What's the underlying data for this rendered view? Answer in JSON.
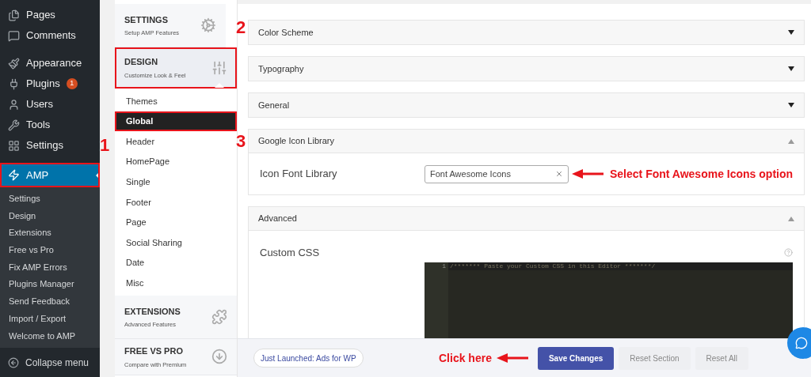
{
  "admin_menu": {
    "items": [
      {
        "label": "Pages",
        "selected": false,
        "highlighted": false
      },
      {
        "label": "Comments",
        "selected": false,
        "highlighted": false
      },
      {
        "label": "Appearance",
        "selected": false,
        "highlighted": false
      },
      {
        "label": "Plugins",
        "badge": "1",
        "selected": false,
        "highlighted": false
      },
      {
        "label": "Users",
        "selected": false,
        "highlighted": false
      },
      {
        "label": "Tools",
        "selected": false,
        "highlighted": false
      },
      {
        "label": "Settings",
        "selected": false,
        "highlighted": false,
        "callout": "1"
      },
      {
        "label": "AMP",
        "selected": true,
        "highlighted": true
      }
    ],
    "submenu": [
      "Settings",
      "Design",
      "Extensions",
      "Free vs Pro",
      "Fix AMP Errors",
      "Plugins Manager",
      "Send Feedback",
      "Import / Export",
      "Welcome to AMP"
    ],
    "collapse": "Collapse menu"
  },
  "amp_nav": {
    "sections": [
      {
        "title": "SETTINGS",
        "subtitle": "Setup AMP Features",
        "selected": false,
        "highlighted": false,
        "callout": "2"
      },
      {
        "title": "DESIGN",
        "subtitle": "Customize Look & Feel",
        "selected": true,
        "highlighted": true,
        "items": [
          {
            "label": "Themes",
            "selected": false,
            "highlighted": false
          },
          {
            "label": "Global",
            "selected": true,
            "highlighted": true
          },
          {
            "label": "Header",
            "selected": false,
            "highlighted": false,
            "callout": "3"
          },
          {
            "label": "HomePage",
            "selected": false,
            "highlighted": false
          },
          {
            "label": "Single",
            "selected": false,
            "highlighted": false
          },
          {
            "label": "Footer",
            "selected": false,
            "highlighted": false
          },
          {
            "label": "Page",
            "selected": false,
            "highlighted": false
          },
          {
            "label": "Social Sharing",
            "selected": false,
            "highlighted": false
          },
          {
            "label": "Date",
            "selected": false,
            "highlighted": false
          },
          {
            "label": "Misc",
            "selected": false,
            "highlighted": false
          }
        ]
      },
      {
        "title": "EXTENSIONS",
        "subtitle": "Advanced Features",
        "selected": false,
        "highlighted": false
      },
      {
        "title": "FREE VS PRO",
        "subtitle": "Compare with Premium",
        "selected": false,
        "highlighted": false
      }
    ]
  },
  "panels": [
    {
      "title": "Color Scheme",
      "expanded": false
    },
    {
      "title": "Typography",
      "expanded": false
    },
    {
      "title": "General",
      "expanded": false
    },
    {
      "title": "Google Icon Library",
      "expanded": true,
      "fields": [
        {
          "kind": "select",
          "label": "Icon Font Library",
          "value": "Font Awesome Icons",
          "callout": "Select Font Awesome Icons option"
        }
      ]
    },
    {
      "title": "Advanced",
      "expanded": true,
      "fields": [
        {
          "kind": "code",
          "label": "Custom CSS",
          "line_number": "1",
          "value": "/******* Paste your Custom CSS in this Editor *******/"
        }
      ]
    }
  ],
  "footer": {
    "promo": "Just Launched: Ads for WP",
    "callout": "Click here",
    "buttons": [
      {
        "label": "Save Changes",
        "kind": "primary"
      },
      {
        "label": "Reset Section",
        "kind": "secondary"
      },
      {
        "label": "Reset All",
        "kind": "secondary"
      }
    ]
  }
}
